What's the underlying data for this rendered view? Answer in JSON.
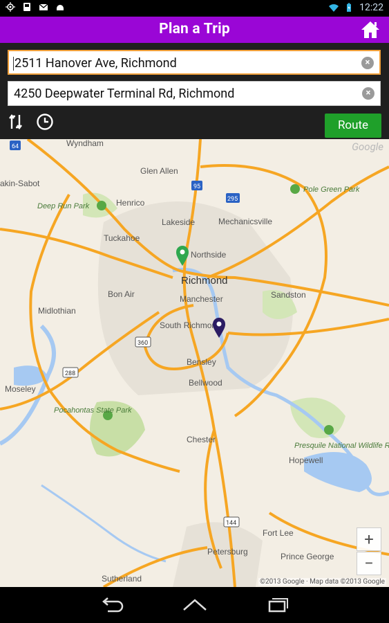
{
  "status_bar": {
    "time": "12:22",
    "icons": [
      "gps-icon",
      "sd-card-icon",
      "email-icon",
      "android-icon",
      "wifi-icon",
      "battery-charging-icon"
    ]
  },
  "app_bar": {
    "title": "Plan a Trip",
    "home_icon": "home-icon"
  },
  "form": {
    "from_value": "2511 Hanover Ave, Richmond",
    "to_value": "4250 Deepwater Terminal Rd, Richmond",
    "swap_icon": "swap-icon",
    "time_icon": "clock-icon",
    "route_label": "Route"
  },
  "map": {
    "logo": "Google",
    "credit": "©2013 Google · Map data ©2013 Google",
    "zoom_in": "+",
    "zoom_out": "−",
    "place_labels": [
      "Wyndham",
      "Glen Allen",
      "akin-Sabot",
      "Pole Green Park",
      "Deep Run Park",
      "Henrico",
      "Lakeside",
      "Mechanicsville",
      "Tuckahoe",
      "Northside",
      "Richmond",
      "Bon Air",
      "Manchester",
      "Sandston",
      "Midlothian",
      "South Richmond",
      "Bensley",
      "Bellwood",
      "Moseley",
      "Pocahontas State Park",
      "Chester",
      "Presquile National Wildlife Refuge",
      "Hopewell",
      "Fort Lee",
      "Petersburg",
      "Prince George",
      "Sutherland"
    ],
    "road_shields": [
      "64",
      "95",
      "295",
      "360",
      "288",
      "144"
    ],
    "colors": {
      "land": "#f3eee4",
      "highway": "#f6a623",
      "water": "#a6c9f2",
      "park": "#c8dfa6",
      "urban": "#e4e0d8",
      "start_marker": "#2fa84f",
      "end_marker": "#2b1c63"
    }
  },
  "nav_bar": {
    "back_icon": "back-icon",
    "home_icon": "nav-home-icon",
    "recents_icon": "recents-icon"
  }
}
